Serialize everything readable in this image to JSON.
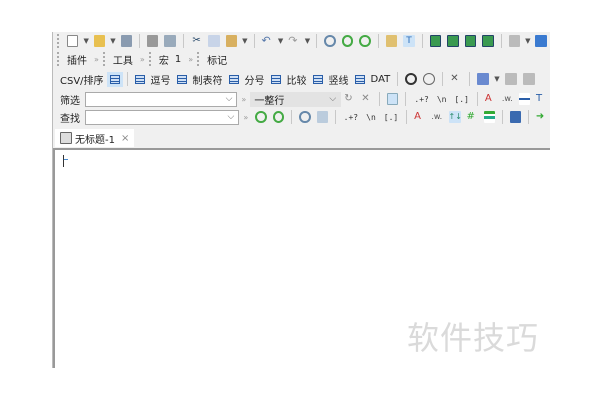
{
  "toolbar1": {
    "icons": [
      "new-file",
      "open-folder",
      "save",
      "print",
      "print-preview",
      "cut",
      "copy",
      "paste",
      "undo",
      "redo",
      "find",
      "find-next",
      "find-prev",
      "find-in-files",
      "filter",
      "view-1",
      "view-2",
      "view-3",
      "view-4",
      "export"
    ]
  },
  "toolbar2": {
    "plugins": "插件",
    "tools": "工具",
    "macro": "宏",
    "macro_num": "1",
    "bookmark": "标记"
  },
  "csvbar": {
    "label": "CSV/排序",
    "items": [
      "逗号",
      "制表符",
      "分号",
      "比较",
      "竖线",
      "DAT"
    ]
  },
  "filter": {
    "label": "筛选",
    "mode": "一整行",
    "regex": ".+?",
    "newline": "\\n",
    "brackets": "[.]"
  },
  "search": {
    "label": "查找",
    "regex": ".+?",
    "newline": "\\n",
    "brackets": "[.]"
  },
  "tab": {
    "title": "无标题-1",
    "close": "×"
  },
  "watermark": "软件技巧"
}
